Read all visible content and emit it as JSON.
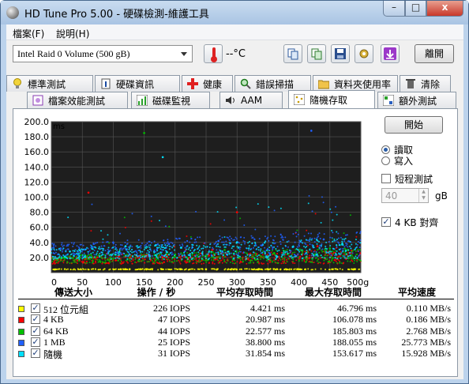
{
  "window": {
    "title": "HD Tune Pro  5.00 - 硬碟檢測-維護工具",
    "min": "–",
    "max": "□",
    "close": "x"
  },
  "menu": [
    {
      "label": "檔案(F)"
    },
    {
      "label": "說明(H)"
    }
  ],
  "toolbar": {
    "drive": "Intel   Raid 0 Volume (500 gB)",
    "temperature": "--°C",
    "exit_label": "離開"
  },
  "tabs_back": [
    {
      "label": "標準測試",
      "icon": "lightbulb-icon"
    },
    {
      "label": "硬碟資訊",
      "icon": "info-icon"
    },
    {
      "label": "健康",
      "icon": "red-cross-icon"
    },
    {
      "label": "錯誤掃描",
      "icon": "magnifier-icon"
    },
    {
      "label": "資料夾使用率",
      "icon": "folder-icon"
    },
    {
      "label": "清除",
      "icon": "trash-icon"
    }
  ],
  "tabs_front": [
    {
      "label": "檔案效能測試",
      "icon": "file-benchmark-icon"
    },
    {
      "label": "磁碟監視",
      "icon": "monitor-chart-icon"
    },
    {
      "label": "AAM",
      "icon": "speaker-icon"
    },
    {
      "label": "隨機存取",
      "icon": "random-access-icon"
    },
    {
      "label": "額外測試",
      "icon": "extra-tests-icon"
    }
  ],
  "controls": {
    "start_label": "開始",
    "read_label": "讀取",
    "write_label": "寫入",
    "short_test_label": "短程測試",
    "short_size": "40",
    "size_unit": "gB",
    "align_label": "4 KB 對齊"
  },
  "chart_data": {
    "type": "scatter",
    "ylabel": "ms",
    "ylim": [
      0,
      200
    ],
    "y_ticks": [
      "200.0",
      "180.0",
      "160.0",
      "140.0",
      "120.0",
      "100.0",
      "80.0",
      "60.0",
      "40.0",
      "20.0"
    ],
    "xlim": [
      0,
      500
    ],
    "x_ticks": [
      "0",
      "50",
      "100",
      "150",
      "200",
      "250",
      "300",
      "350",
      "400",
      "450",
      "500gB"
    ],
    "grid": true,
    "series": [
      {
        "name": "512 位元組",
        "color": "#ffff00",
        "typical_ms": 4.4,
        "values": [
          [
            5,
            4.2
          ],
          [
            120,
            4.5
          ],
          [
            250,
            4.4
          ],
          [
            380,
            4.3
          ],
          [
            490,
            4.5
          ]
        ]
      },
      {
        "name": "4 KB",
        "color": "#ff0000",
        "typical_ms": 21,
        "values": [
          [
            10,
            18
          ],
          [
            90,
            25
          ],
          [
            180,
            20
          ],
          [
            260,
            30
          ],
          [
            350,
            22
          ],
          [
            430,
            35
          ],
          [
            60,
            106
          ],
          [
            300,
            80
          ]
        ]
      },
      {
        "name": "64 KB",
        "color": "#00c000",
        "typical_ms": 22.6,
        "values": [
          [
            20,
            20
          ],
          [
            110,
            28
          ],
          [
            200,
            24
          ],
          [
            280,
            30
          ],
          [
            360,
            26
          ],
          [
            450,
            32
          ],
          [
            150,
            185
          ]
        ]
      },
      {
        "name": "1 MB",
        "color": "#2060ff",
        "typical_ms": 38.8,
        "values": [
          [
            15,
            32
          ],
          [
            100,
            40
          ],
          [
            190,
            38
          ],
          [
            270,
            42
          ],
          [
            340,
            36
          ],
          [
            440,
            44
          ],
          [
            420,
            188
          ]
        ]
      },
      {
        "name": "隨機",
        "color": "#00e0ff",
        "typical_ms": 31.9,
        "values": [
          [
            30,
            28
          ],
          [
            120,
            35
          ],
          [
            210,
            33
          ],
          [
            300,
            40
          ],
          [
            390,
            34
          ],
          [
            470,
            38
          ],
          [
            180,
            153
          ]
        ]
      }
    ]
  },
  "table": {
    "headers": [
      "傳送大小",
      "操作 / 秒",
      "平均存取時間",
      "最大存取時間",
      "平均速度"
    ],
    "rows": [
      {
        "color": "#ffff00",
        "checked": "✓",
        "size": "512 位元組",
        "iops": "226 IOPS",
        "avg": "4.421  ms",
        "max": "46.796  ms",
        "speed": "0.110  MB/s"
      },
      {
        "color": "#ff0000",
        "checked": "✓",
        "size": "4 KB",
        "iops": "47 IOPS",
        "avg": "20.987  ms",
        "max": "106.078  ms",
        "speed": "0.186  MB/s"
      },
      {
        "color": "#00c000",
        "checked": "✓",
        "size": "64 KB",
        "iops": "44 IOPS",
        "avg": "22.577  ms",
        "max": "185.803  ms",
        "speed": "2.768  MB/s"
      },
      {
        "color": "#2060ff",
        "checked": "✓",
        "size": "1 MB",
        "iops": "25 IOPS",
        "avg": "38.800  ms",
        "max": "188.055  ms",
        "speed": "25.773  MB/s"
      },
      {
        "color": "#00e0ff",
        "checked": "✓",
        "size": "隨機",
        "iops": "31 IOPS",
        "avg": "31.854  ms",
        "max": "153.617  ms",
        "speed": "15.928  MB/s"
      }
    ]
  }
}
